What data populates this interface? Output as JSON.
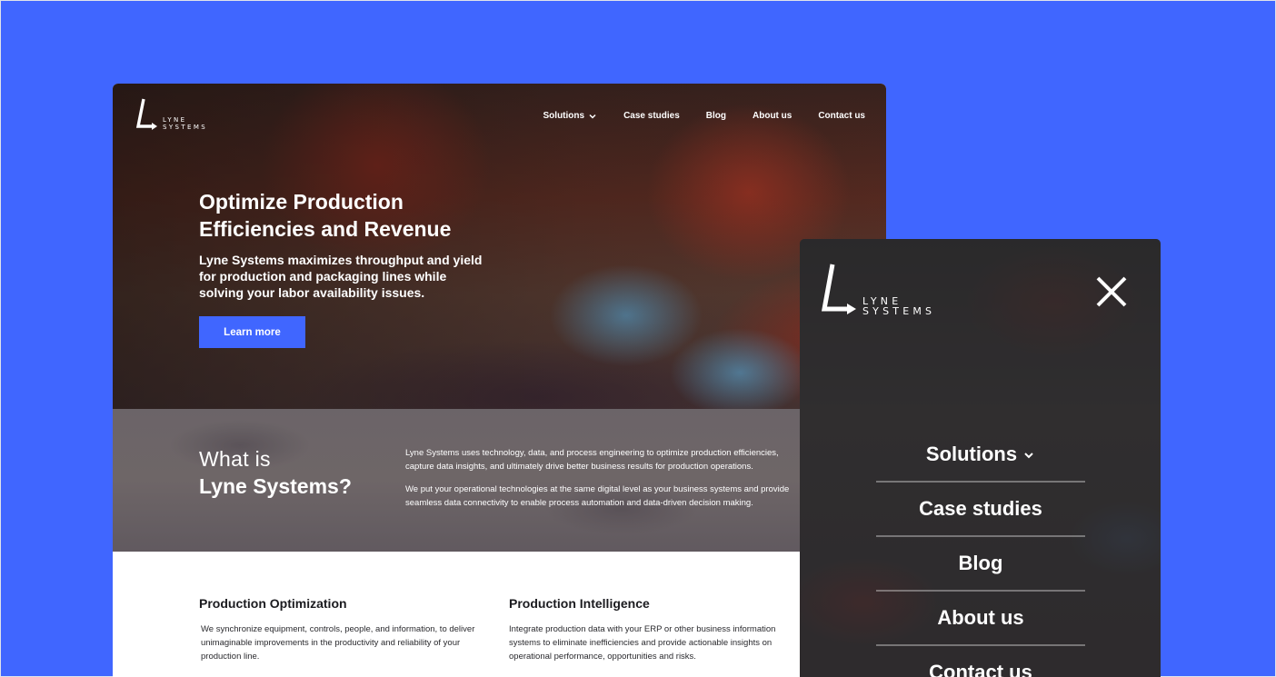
{
  "brand": {
    "logo_line1": "LYNE",
    "logo_line2": "SYSTEMS"
  },
  "nav": {
    "items": [
      {
        "label": "Solutions",
        "has_dropdown": true
      },
      {
        "label": "Case studies"
      },
      {
        "label": "Blog"
      },
      {
        "label": "About us"
      },
      {
        "label": "Contact us"
      }
    ]
  },
  "hero": {
    "title_line1": "Optimize Production",
    "title_line2": "Efficiencies and Revenue",
    "subtitle": "Lyne Systems maximizes throughput and yield for production and packaging lines while solving your labor availability issues.",
    "cta_label": "Learn more"
  },
  "about": {
    "heading_line1": "What is",
    "heading_line2": "Lyne Systems?",
    "paragraph1": "Lyne Systems uses technology, data, and process engineering to optimize production efficiencies, capture data insights, and ultimately drive better business results for production operations.",
    "paragraph2": "We put your operational technologies at the same digital level as your business systems and provide seamless data connectivity to enable process automation and data-driven decision making."
  },
  "features": [
    {
      "title": "Production Optimization",
      "text": "We synchronize equipment, controls, people, and information, to deliver unimaginable improvements in the productivity and reliability of your production line."
    },
    {
      "title": "Production Intelligence",
      "text": "Integrate production data with your ERP or other business information systems to eliminate inefficiencies and provide actionable insights on operational performance, opportunities and risks."
    }
  ],
  "colors": {
    "page_background": "#4066ff",
    "accent": "#4066ff"
  }
}
